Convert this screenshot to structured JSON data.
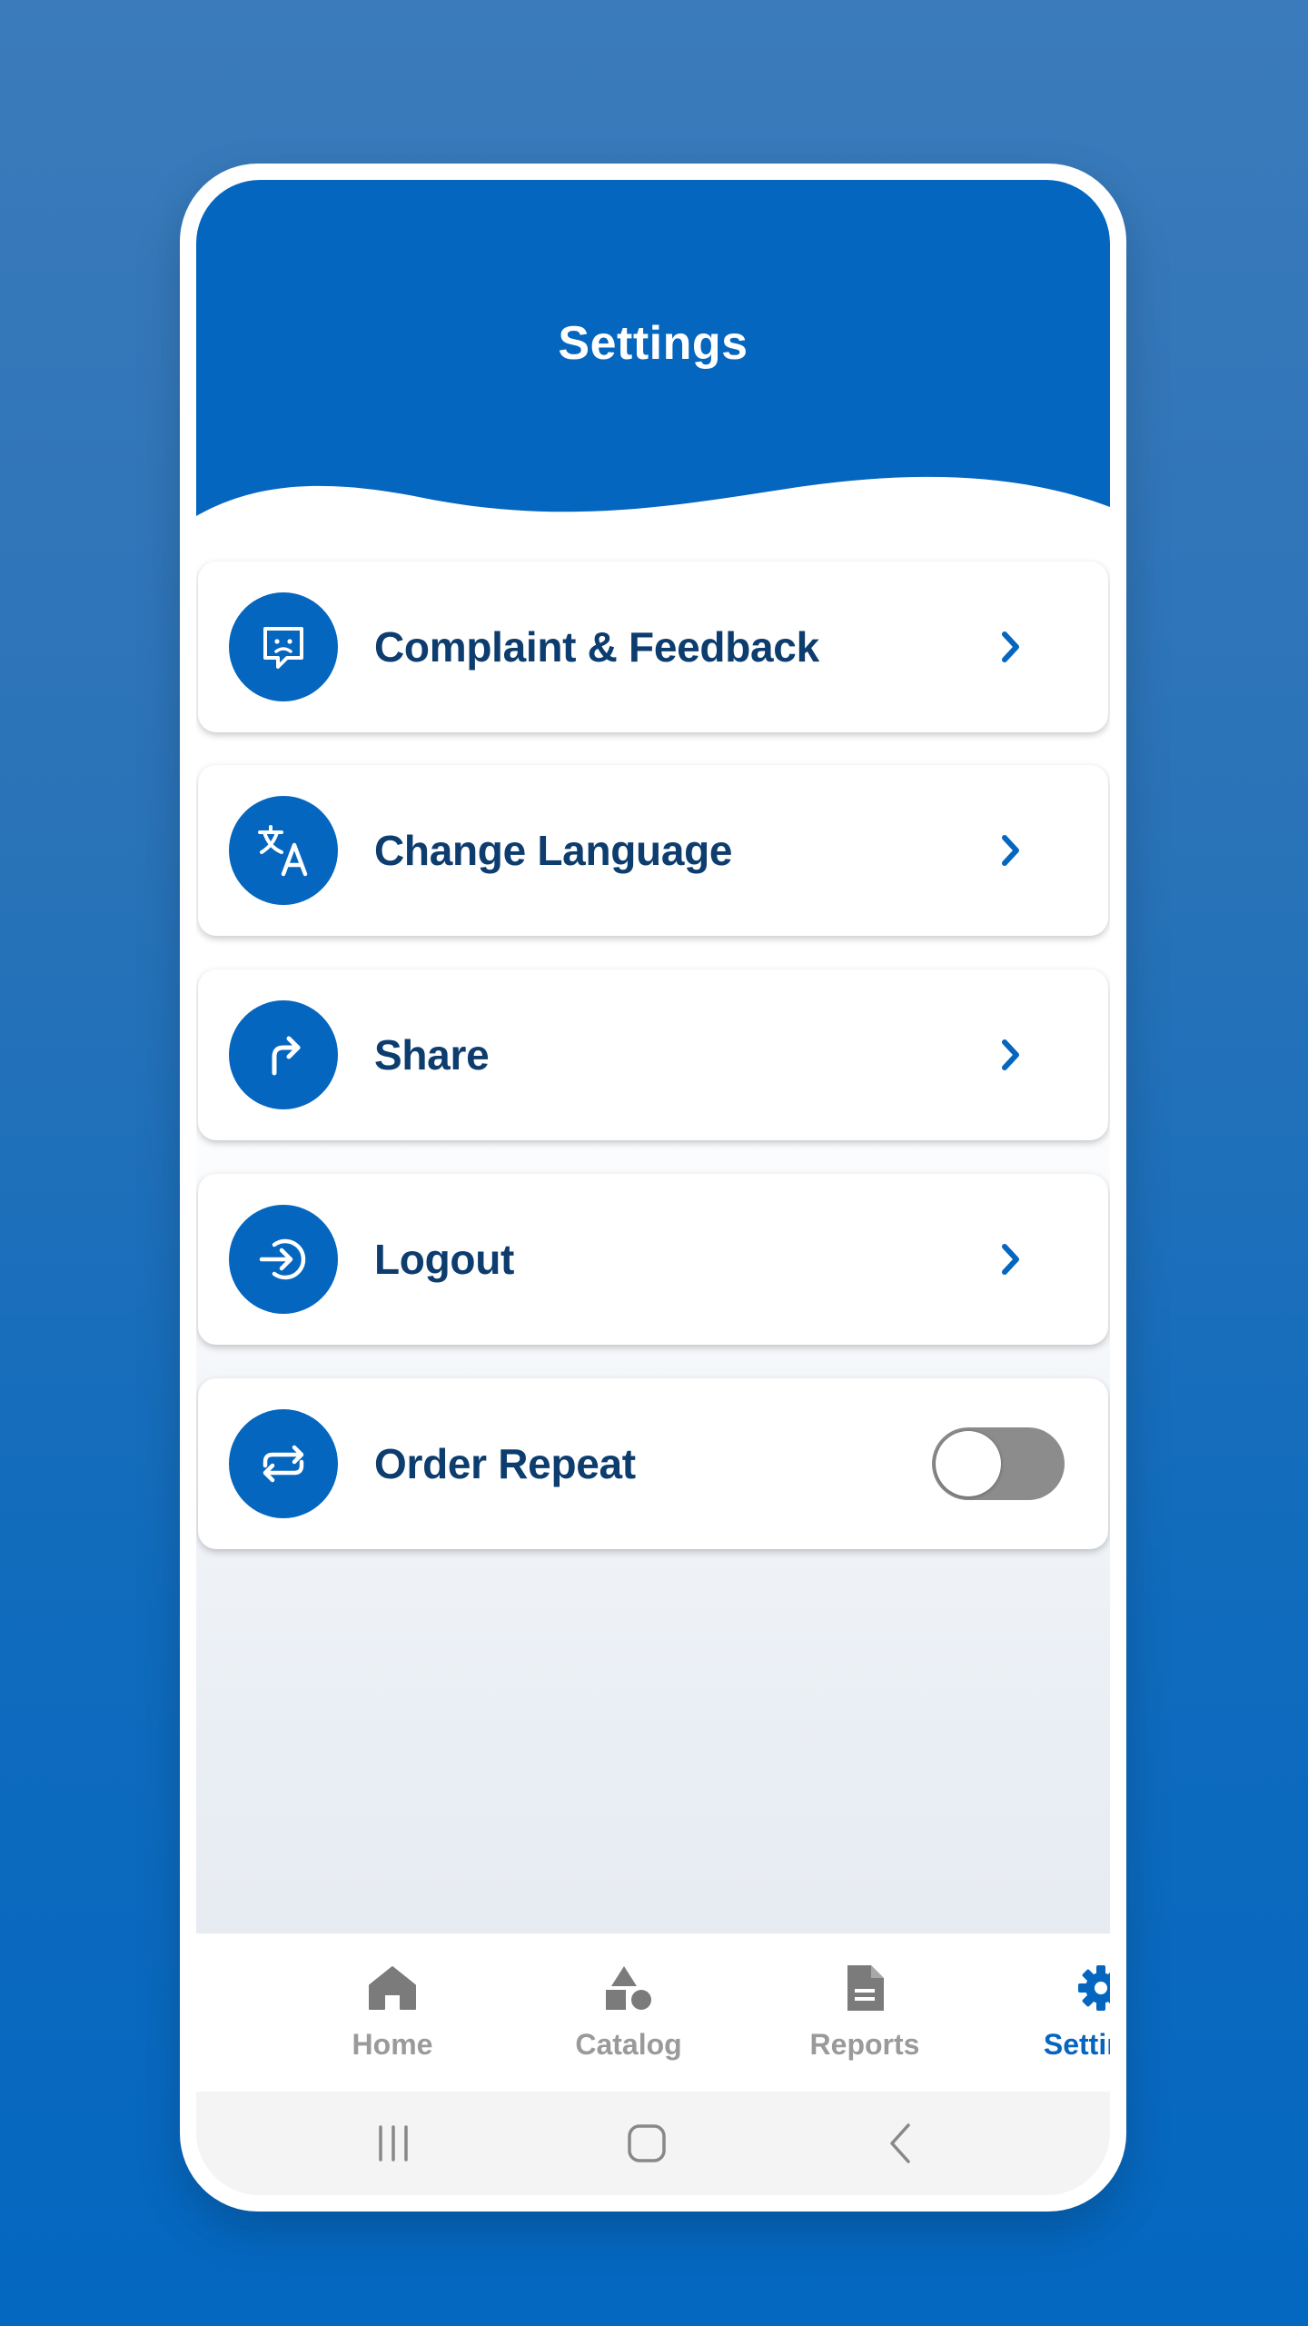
{
  "header": {
    "title": "Settings"
  },
  "colors": {
    "primary": "#0566bf",
    "text_dark": "#0d3d6e",
    "tab_inactive": "#9a9a9a",
    "toggle_off": "#8c8c8c"
  },
  "menu": [
    {
      "label": "Complaint & Feedback",
      "icon": "sad-face-message-icon",
      "trailing": "chevron"
    },
    {
      "label": "Change Language",
      "icon": "translate-icon",
      "trailing": "chevron"
    },
    {
      "label": "Share",
      "icon": "share-arrow-icon",
      "trailing": "chevron"
    },
    {
      "label": "Logout",
      "icon": "logout-icon",
      "trailing": "chevron"
    },
    {
      "label": "Order Repeat",
      "icon": "repeat-icon",
      "trailing": "toggle",
      "toggle_on": false
    }
  ],
  "tabs": [
    {
      "label": "Home",
      "icon": "home-icon",
      "active": false
    },
    {
      "label": "Catalog",
      "icon": "shapes-icon",
      "active": false
    },
    {
      "label": "Reports",
      "icon": "document-icon",
      "active": false
    },
    {
      "label": "Settings",
      "icon": "gear-icon",
      "active": true
    }
  ],
  "system_nav": [
    "recent-apps-icon",
    "home-button-icon",
    "back-icon"
  ]
}
